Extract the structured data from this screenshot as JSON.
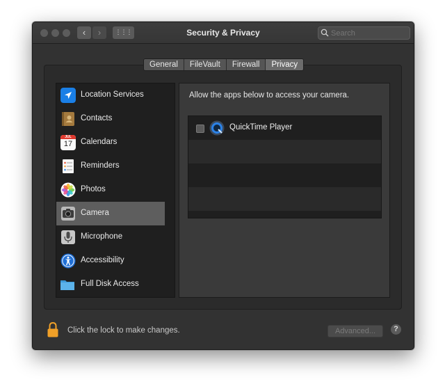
{
  "window": {
    "title": "Security & Privacy"
  },
  "search": {
    "placeholder": "Search"
  },
  "toolbar": {
    "back_glyph": "‹",
    "forward_glyph": "›",
    "grid_glyph": "⋮⋮⋮"
  },
  "tabs": [
    {
      "label": "General",
      "selected": false
    },
    {
      "label": "FileVault",
      "selected": false
    },
    {
      "label": "Firewall",
      "selected": false
    },
    {
      "label": "Privacy",
      "selected": true
    }
  ],
  "sidebar": {
    "items": [
      {
        "label": "Location Services",
        "icon": "location-arrow-icon",
        "selected": false
      },
      {
        "label": "Contacts",
        "icon": "contacts-book-icon",
        "selected": false
      },
      {
        "label": "Calendars",
        "icon": "calendar-icon",
        "selected": false
      },
      {
        "label": "Reminders",
        "icon": "reminders-list-icon",
        "selected": false
      },
      {
        "label": "Photos",
        "icon": "photos-pinwheel-icon",
        "selected": false
      },
      {
        "label": "Camera",
        "icon": "camera-icon",
        "selected": true
      },
      {
        "label": "Microphone",
        "icon": "microphone-icon",
        "selected": false
      },
      {
        "label": "Accessibility",
        "icon": "accessibility-person-icon",
        "selected": false
      },
      {
        "label": "Full Disk Access",
        "icon": "folder-icon",
        "selected": false
      }
    ],
    "calendar_month": "JUL",
    "calendar_day": "17"
  },
  "detail": {
    "heading": "Allow the apps below to access your camera.",
    "apps": [
      {
        "name": "QuickTime Player",
        "checked": false,
        "icon": "quicktime-icon"
      }
    ]
  },
  "footer": {
    "lock_label": "Click the lock to make changes.",
    "advanced_label": "Advanced...",
    "help_label": "?"
  },
  "colors": {
    "window_bg": "#323232",
    "selection": "#5e5e5e",
    "location_blue": "#1a7fe6",
    "lock_orange": "#f0a028"
  }
}
